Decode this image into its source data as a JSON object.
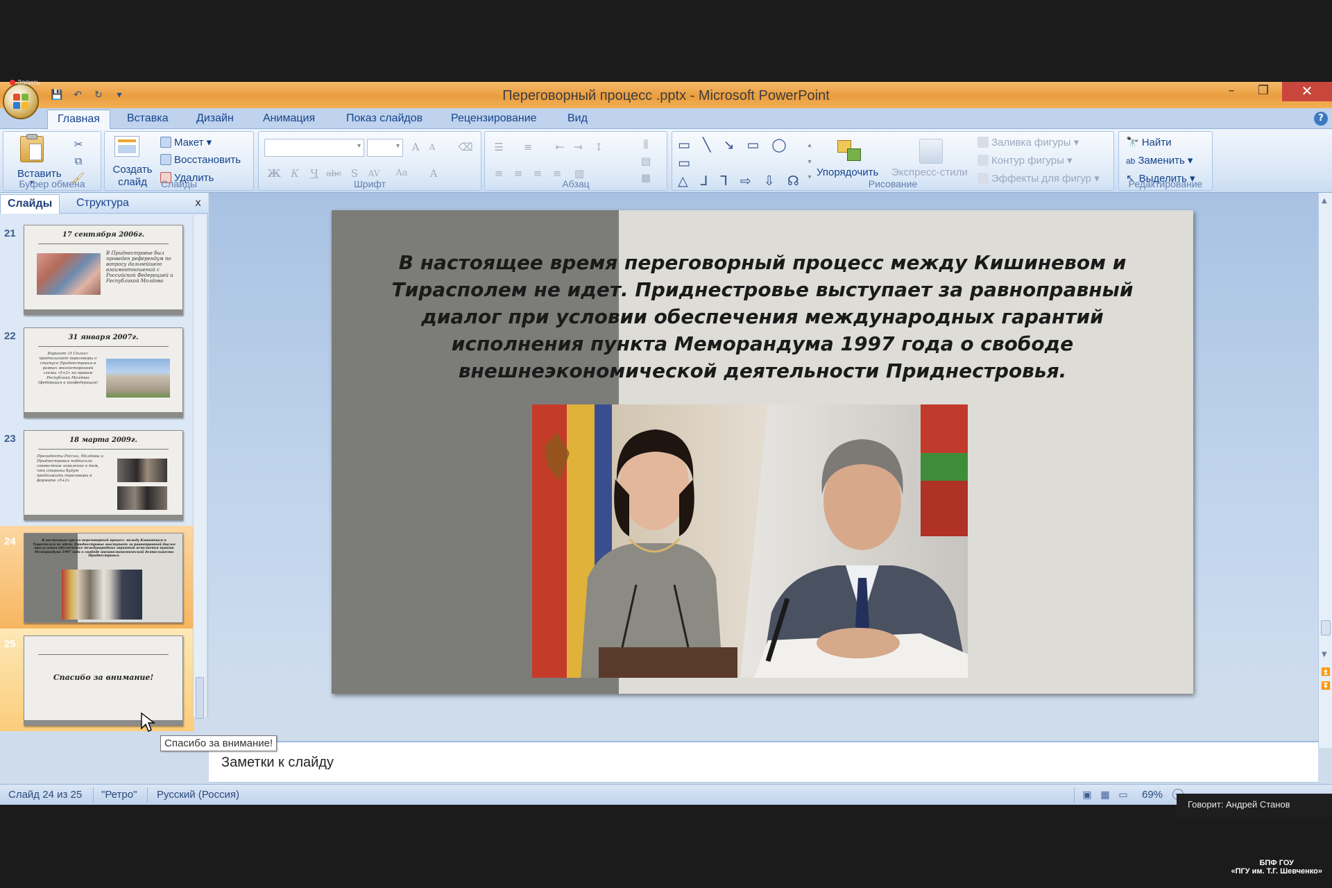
{
  "recording": {
    "label": "Запись"
  },
  "window": {
    "title": "Переговорный процесс .pptx - Microsoft PowerPoint",
    "minimize": "–",
    "restore": "❐",
    "close": "✕"
  },
  "ribbon_tabs": [
    "Главная",
    "Вставка",
    "Дизайн",
    "Анимация",
    "Показ слайдов",
    "Рецензирование",
    "Вид"
  ],
  "active_tab": "Главная",
  "ribbon": {
    "clipboard": {
      "paste": "Вставить",
      "label": "Буфер обмена"
    },
    "slides": {
      "create": "Создать слайд",
      "layout": "Макет",
      "reset": "Восстановить",
      "delete": "Удалить",
      "label": "Слайды"
    },
    "font": {
      "label": "Шрифт"
    },
    "paragraph": {
      "label": "Абзац"
    },
    "drawing": {
      "arrange": "Упорядочить",
      "quick_styles": "Экспресс-стили",
      "fill": "Заливка фигуры",
      "outline": "Контур фигуры",
      "effects": "Эффекты для фигур",
      "label": "Рисование"
    },
    "editing": {
      "find": "Найти",
      "replace": "Заменить",
      "select": "Выделить",
      "label": "Редактирование"
    }
  },
  "pane": {
    "tab_slides": "Слайды",
    "tab_outline": "Структура",
    "close": "x"
  },
  "thumbnails": [
    {
      "num": "21",
      "title": "17 сентября 2006г.",
      "text": "В Приднестровье был проведен референдум по вопросу дальнейшего взаимоотношений с Российской Федерацией и Республикой Молдова"
    },
    {
      "num": "22",
      "title": "31 января 2007г.",
      "text": "Вариант «5 Сплан» предполагает переговоры о статусе Приднестровья в рамках многосторонней схемы «5+2» по правам Республики Молдова (федерация и конфедерация)"
    },
    {
      "num": "23",
      "title": "18 марта 2009г.",
      "text": "Президенты России, Молдовы и Приднестровья подписали совместное заявление о том, что стороны будут продолжать переговоры в формате «5+2»"
    },
    {
      "num": "24",
      "title": "",
      "text": "В настоящее время переговорный процесс между Кишиневом и Тирасполем не идет. Приднестровье выступает за равноправный диалог при условии обеспечения международных гарантий исполнения пункта Меморандума 1997 года о свободе внешнеэкономической деятельности Приднестровья."
    },
    {
      "num": "25",
      "title": "",
      "text": "Спасибо за внимание!"
    }
  ],
  "slide": {
    "text": "В настоящее время переговорный процесс между Кишиневом и Тирасполем не идет. Приднестровье выступает за равноправный диалог при условии обеспечения международных гарантий исполнения пункта Меморандума 1997 года о свободе внешнеэкономической деятельности Приднестровья."
  },
  "tooltip": "Спасибо за внимание!",
  "notes_placeholder": "Заметки к слайду",
  "status": {
    "slide": "Слайд 24 из 25",
    "theme": "\"Ретро\"",
    "language": "Русский (Россия)",
    "zoom": "69%"
  },
  "speaker": "Говорит: Андрей Станов",
  "watermark": {
    "line1": "БПФ ГОУ",
    "line2": "«ПГУ им. Т.Г. Шевченко»"
  },
  "colors": {
    "titlebar": "#f0a84b",
    "ribbon": "#dce8f6",
    "selected_thumb": "#f7b660",
    "slide_bg": "#dddcd7",
    "slide_band": "#7c7c79"
  }
}
